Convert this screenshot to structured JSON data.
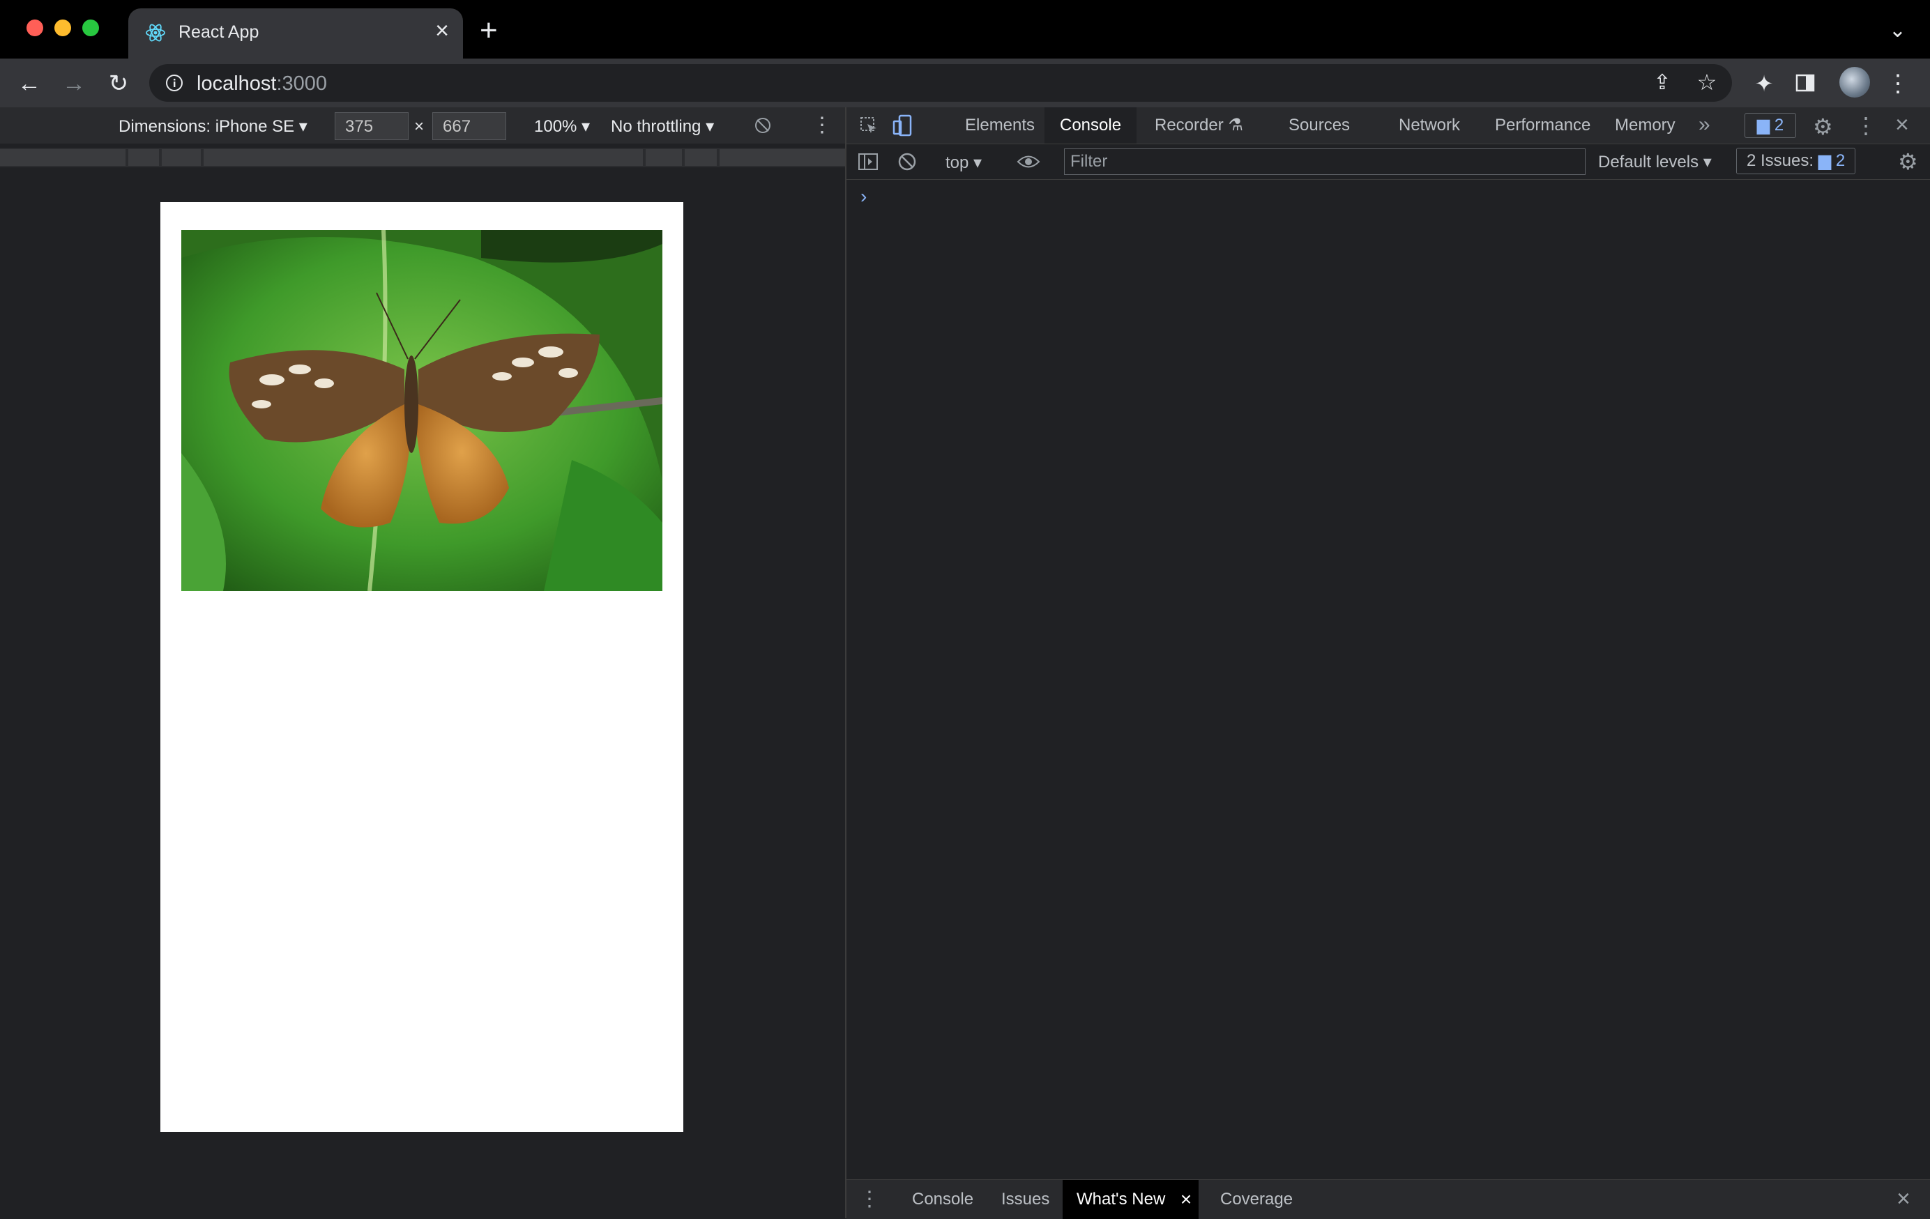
{
  "browser": {
    "tab_title": "React App",
    "url_host": "localhost",
    "url_port": ":3000"
  },
  "device_toolbar": {
    "dimensions_label": "Dimensions: iPhone SE ▾",
    "width": "375",
    "height": "667",
    "times": "×",
    "zoom": "100% ▾",
    "throttling": "No throttling ▾"
  },
  "devtools": {
    "tabs": [
      "Elements",
      "Console",
      "Recorder",
      "Sources",
      "Network",
      "Performance",
      "Memory"
    ],
    "issues_badge": "2",
    "context": "top ▾",
    "filter_placeholder": "Filter",
    "levels": "Default levels ▾",
    "issues_label": "2 Issues:",
    "issues_count": "2",
    "prompt": "›"
  },
  "drawer": {
    "tabs": [
      "Console",
      "Issues",
      "What's New",
      "Coverage"
    ],
    "active_close": "×"
  }
}
